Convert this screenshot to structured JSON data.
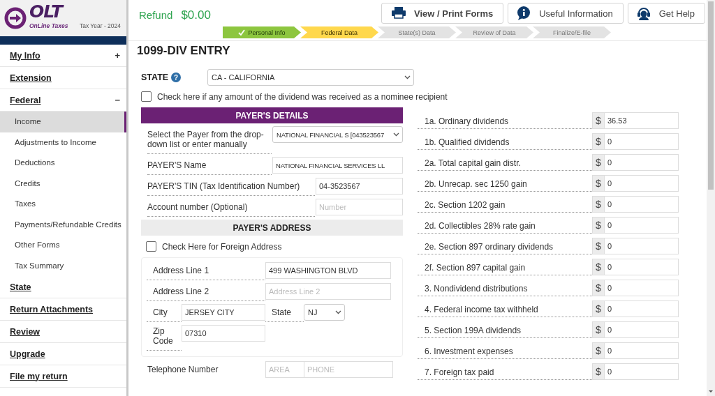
{
  "logo": {
    "mark": "OLT",
    "tagline": "OnLine Taxes",
    "tax_year": "Tax Year - 2024"
  },
  "sidebar": {
    "items": [
      {
        "label": "My Info",
        "expander": "+"
      },
      {
        "label": "Extension"
      },
      {
        "label": "Federal",
        "expander": "−",
        "children": [
          {
            "label": "Income",
            "selected": true
          },
          {
            "label": "Adjustments to Income",
            "selected": false
          },
          {
            "label": "Deductions",
            "selected": false
          },
          {
            "label": "Credits",
            "selected": false
          },
          {
            "label": "Taxes",
            "selected": false
          },
          {
            "label": "Payments/Refundable Credits",
            "selected": false
          },
          {
            "label": "Other Forms",
            "selected": false
          },
          {
            "label": "Tax Summary",
            "selected": false
          }
        ]
      },
      {
        "label": "State"
      },
      {
        "label": "Return Attachments"
      },
      {
        "label": "Review"
      },
      {
        "label": "Upgrade"
      },
      {
        "label": "File my return"
      }
    ]
  },
  "refund": {
    "label": "Refund",
    "amount": "$0.00"
  },
  "header_buttons": [
    {
      "label": "View / Print Forms",
      "primary": true
    },
    {
      "label": "Useful Information",
      "primary": false
    },
    {
      "label": "Get Help",
      "primary": false
    }
  ],
  "progress_steps": [
    {
      "label": "Personal Info",
      "completed": true,
      "selected": false
    },
    {
      "label": "Federal Data",
      "completed": false,
      "selected": true
    },
    {
      "label": "State(s) Data",
      "completed": false,
      "selected": false
    },
    {
      "label": "Review of Data",
      "completed": false,
      "selected": false
    },
    {
      "label": "Finalize/E-file",
      "completed": false,
      "selected": false
    }
  ],
  "title": "1099-DIV ENTRY",
  "state": {
    "label": "STATE",
    "help": "?",
    "value": "CA - CALIFORNIA"
  },
  "nominee": {
    "label": "Check here if any amount of the dividend was received as a nominee recipient",
    "checked": false
  },
  "payer_details": {
    "heading": "PAYER'S DETAILS",
    "fields": [
      {
        "kind": "select",
        "label": "Select the Payer from the drop-down list or enter manually",
        "value": "NATIONAL FINANCIAL S [043523567"
      },
      {
        "kind": "text",
        "label": "PAYER'S Name",
        "value": "NATIONAL FINANCIAL SERVICES LL"
      },
      {
        "kind": "text",
        "label": "PAYER'S TIN (Tax Identification Number)",
        "value": "04-3523567"
      },
      {
        "kind": "text",
        "label": "Account number (Optional)",
        "placeholder": "Number"
      }
    ]
  },
  "payer_address": {
    "heading": "PAYER'S ADDRESS",
    "foreign": {
      "label": "Check Here for Foreign Address",
      "checked": false
    },
    "address_line_1": {
      "label": "Address Line 1",
      "value": "499 WASHINGTON BLVD"
    },
    "address_line_2": {
      "label": "Address Line 2",
      "placeholder": "Address Line 2"
    },
    "city": {
      "label": "City",
      "value": "JERSEY CITY"
    },
    "state": {
      "label": "State",
      "value": "NJ"
    },
    "zip": {
      "label": "Zip Code",
      "value": "07310"
    }
  },
  "telephone": {
    "label": "Telephone Number",
    "area_placeholder": "AREA",
    "phone_placeholder": "PHONE"
  },
  "amounts": [
    {
      "label": "1a. Ordinary dividends",
      "currency": "$",
      "value": "36.53"
    },
    {
      "label": "1b. Qualified dividends",
      "currency": "$",
      "value": "0"
    },
    {
      "label": "2a. Total capital gain distr.",
      "currency": "$",
      "value": "0"
    },
    {
      "label": "2b. Unrecap. sec 1250 gain",
      "currency": "$",
      "value": "0"
    },
    {
      "label": "2c. Section 1202 gain",
      "currency": "$",
      "value": "0"
    },
    {
      "label": "2d. Collectibles 28% rate gain",
      "currency": "$",
      "value": "0"
    },
    {
      "label": "2e. Section 897 ordinary dividends",
      "currency": "$",
      "value": "0"
    },
    {
      "label": "2f. Section 897 capital gain",
      "currency": "$",
      "value": "0"
    },
    {
      "label": "3. Nondividend distributions",
      "currency": "$",
      "value": "0"
    },
    {
      "label": "4. Federal income tax withheld",
      "currency": "$",
      "value": "0"
    },
    {
      "label": "5. Section 199A dividends",
      "currency": "$",
      "value": "0"
    },
    {
      "label": "6. Investment expenses",
      "currency": "$",
      "value": "0"
    },
    {
      "label": "7. Foreign tax paid",
      "currency": "$",
      "value": "0"
    }
  ]
}
